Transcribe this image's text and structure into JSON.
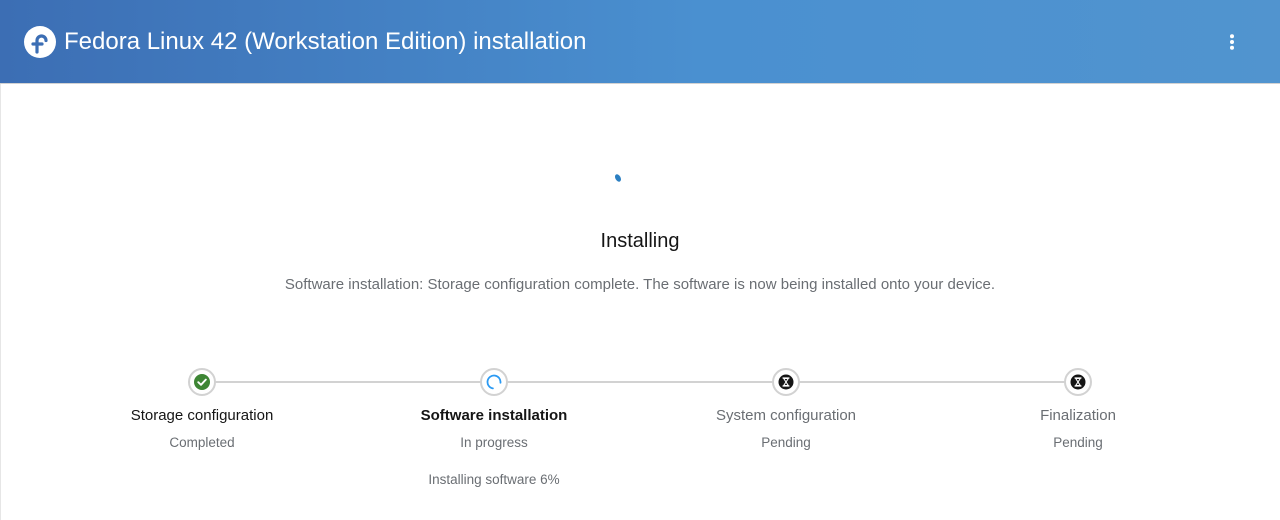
{
  "header": {
    "title": "Fedora Linux 42 (Workstation Edition) installation",
    "logo_icon": "fedora-logo-icon",
    "menu_icon": "kebab-menu-icon",
    "background": "#4a90d0"
  },
  "main": {
    "spinner_icon": "loading-spinner-icon",
    "heading": "Installing",
    "description": "Software installation: Storage configuration complete. The software is now being installed onto your device."
  },
  "steps": [
    {
      "title": "Storage configuration",
      "status": "Completed",
      "state": "completed",
      "icon": "check-circle-icon",
      "color": "#3e8635"
    },
    {
      "title": "Software installation",
      "status": "In progress",
      "state": "in-progress",
      "icon": "in-progress-spinner-icon",
      "color": "#2b9af3",
      "detail": "Installing software 6%"
    },
    {
      "title": "System configuration",
      "status": "Pending",
      "state": "pending",
      "icon": "hourglass-icon",
      "color": "#151515"
    },
    {
      "title": "Finalization",
      "status": "Pending",
      "state": "pending",
      "icon": "hourglass-icon",
      "color": "#151515"
    }
  ]
}
